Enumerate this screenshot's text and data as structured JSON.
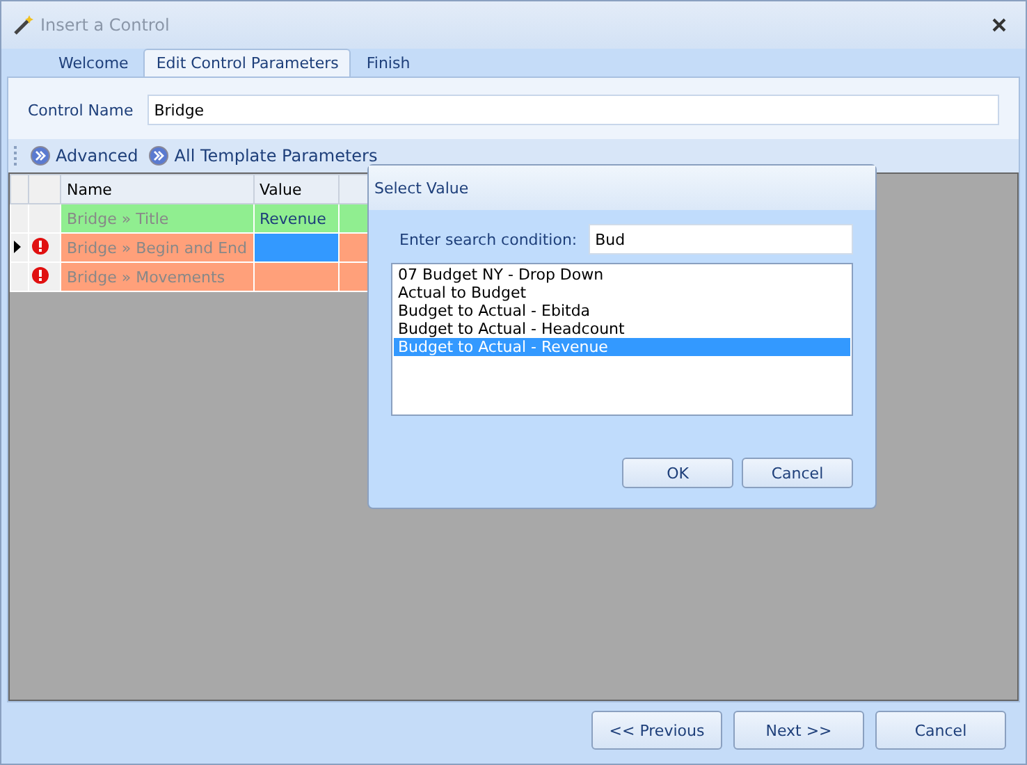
{
  "window": {
    "title": "Insert a Control"
  },
  "tabs": [
    {
      "label": "Welcome",
      "selected": false
    },
    {
      "label": "Edit Control Parameters",
      "selected": true
    },
    {
      "label": "Finish",
      "selected": false
    }
  ],
  "control_name": {
    "label": "Control Name",
    "value": "Bridge"
  },
  "toolbar": [
    "Advanced",
    "All Template Parameters"
  ],
  "grid": {
    "columns": [
      "Name",
      "Value"
    ],
    "rows": [
      {
        "name": "Bridge » Title",
        "value": "Revenue",
        "error": false,
        "current": false,
        "selected": false
      },
      {
        "name": "Bridge » Begin and End",
        "error": true,
        "current": true,
        "selected": true
      },
      {
        "name": "Bridge » Movements",
        "error": true,
        "current": false,
        "selected": false
      }
    ]
  },
  "dialog": {
    "title": "Select Value",
    "search_label": "Enter search condition:",
    "search_value": "Bud",
    "items": [
      {
        "label": "07 Budget NY - Drop Down",
        "selected": false
      },
      {
        "label": "Actual to Budget",
        "selected": false
      },
      {
        "label": "Budget to Actual - Ebitda",
        "selected": false
      },
      {
        "label": "Budget to Actual - Headcount",
        "selected": false
      },
      {
        "label": "Budget to Actual - Revenue",
        "selected": true
      }
    ],
    "buttons": [
      "OK",
      "Cancel"
    ]
  },
  "buttons": [
    "<< Previous",
    "Next >>",
    "Cancel"
  ]
}
